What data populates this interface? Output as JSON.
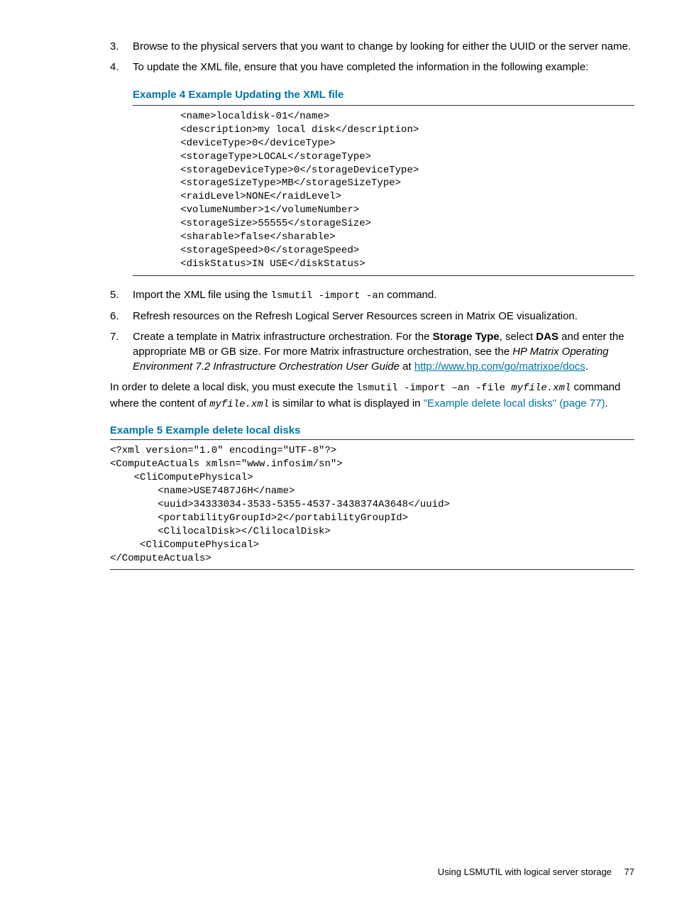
{
  "steps": {
    "s3": {
      "num": "3.",
      "text": "Browse to the physical servers that you want to change by looking for either the UUID or the server name."
    },
    "s4": {
      "num": "4.",
      "text": "To update the XML file, ensure that you have completed the information in the following example:"
    },
    "s5": {
      "num": "5.",
      "pre": "Import the XML file using the ",
      "code": "lsmutil -import -an",
      "post": " command."
    },
    "s6": {
      "num": "6.",
      "text": "Refresh resources on the Refresh Logical Server Resources screen in Matrix OE visualization."
    },
    "s7": {
      "num": "7.",
      "t1": "Create a template in Matrix infrastructure orchestration. For the ",
      "b1": "Storage Type",
      "t2": ", select ",
      "b2": "DAS",
      "t3": " and enter the appropriate MB or GB size. For more Matrix infrastructure orchestration, see the ",
      "i1": "HP Matrix Operating Environment 7.2 Infrastructure Orchestration User Guide",
      "t4": " at ",
      "link": "http://www.hp.com/go/matrixoe/docs",
      "t5": "."
    }
  },
  "example4": {
    "title": "Example 4 Example Updating the XML file",
    "code": "        <name>localdisk-01</name>\n        <description>my local disk</description>\n        <deviceType>0</deviceType>\n        <storageType>LOCAL</storageType>\n        <storageDeviceType>0</storageDeviceType>\n        <storageSizeType>MB</storageSizeType>\n        <raidLevel>NONE</raidLevel>\n        <volumeNumber>1</volumeNumber>\n        <storageSize>55555</storageSize>\n        <sharable>false</sharable>\n        <storageSpeed>0</storageSpeed>\n        <diskStatus>IN USE</diskStatus>"
  },
  "deletepara": {
    "t1": "In order to delete a local disk, you must execute the ",
    "c1": "lsmutil -import –an -file ",
    "ci1": "myfile.xml",
    "t2": " command where the content of ",
    "ci2": "myfile.xml",
    "t3": " is similar to what is displayed in ",
    "ref": "\"Example delete local disks\" (page 77)",
    "t4": "."
  },
  "example5": {
    "title": "Example 5 Example delete local disks",
    "code": "<?xml version=\"1.0\" encoding=\"UTF-8\"?>\n<ComputeActuals xmlsn=\"www.infosim/sn\">\n    <CliComputePhysical>\n        <name>USE7487J6H</name>\n        <uuid>34333034-3533-5355-4537-3438374A3648</uuid>\n        <portabilityGroupId>2</portabilityGroupId>\n        <ClilocalDisk></ClilocalDisk>\n     <CliComputePhysical>\n</ComputeActuals>"
  },
  "footer": {
    "text": "Using LSMUTIL with logical server storage",
    "page": "77"
  }
}
